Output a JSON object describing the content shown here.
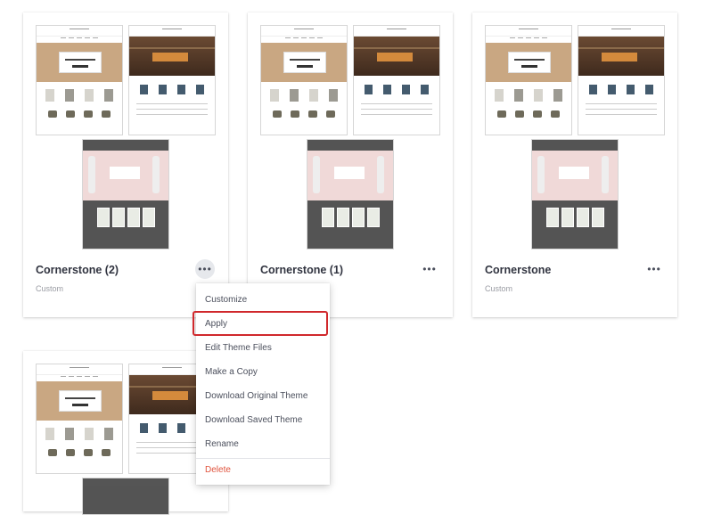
{
  "themes": [
    {
      "title": "Cornerstone (2)",
      "subtitle": "Custom"
    },
    {
      "title": "Cornerstone (1)",
      "subtitle": "Custom"
    },
    {
      "title": "Cornerstone",
      "subtitle": "Custom"
    }
  ],
  "more_button_label": "•••",
  "preview_text": {
    "hero_tan": "Books for Cooks",
    "hero_pink": "Spring Fashion"
  },
  "context_menu": {
    "items": [
      {
        "label": "Customize"
      },
      {
        "label": "Apply"
      },
      {
        "label": "Edit Theme Files"
      },
      {
        "label": "Make a Copy"
      },
      {
        "label": "Download Original Theme"
      },
      {
        "label": "Download Saved Theme"
      },
      {
        "label": "Rename"
      },
      {
        "label": "Delete"
      }
    ]
  },
  "colors": {
    "danger": "#e0533d",
    "highlight": "#d0282c",
    "active_button": "#e6e8ec"
  }
}
